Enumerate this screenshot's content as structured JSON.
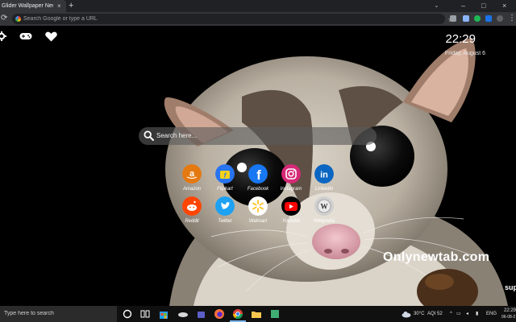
{
  "browser": {
    "tab_title": "Glider Wallpaper New Tab",
    "tab_close": "×",
    "new_tab": "+",
    "tabstrip_chevron": "⌄",
    "window_controls": {
      "minimize": "–",
      "maximize": "□",
      "close": "×"
    },
    "omnibox_placeholder": "Search Google or type a URL"
  },
  "page": {
    "clock_time": "22:29",
    "clock_date": "Friday, August 6",
    "search_placeholder": "Search here...",
    "watermark": "Onlynewtab.com",
    "edge_text": "sup",
    "quick_links": [
      {
        "label": "Amazon",
        "icon": "amazon-icon",
        "color": "#e47911"
      },
      {
        "label": "Flipkart",
        "icon": "flipkart-icon",
        "color": "#2874f0"
      },
      {
        "label": "Facebook",
        "icon": "facebook-icon",
        "color": "#1877f2"
      },
      {
        "label": "Instagram",
        "icon": "instagram-icon",
        "color": "#d62976"
      },
      {
        "label": "Linkedin",
        "icon": "linkedin-icon",
        "color": "#0a66c2"
      },
      {
        "label": "Reddit",
        "icon": "reddit-icon",
        "color": "#ff4500"
      },
      {
        "label": "Twitter",
        "icon": "twitter-icon",
        "color": "#1da1f2"
      },
      {
        "label": "Walmart",
        "icon": "walmart-icon",
        "color": "#0071ce"
      },
      {
        "label": "Youtube",
        "icon": "youtube-icon",
        "color": "#ff0000"
      },
      {
        "label": "Wikipedia",
        "icon": "wikipedia-icon",
        "color": "#cfcfcf"
      }
    ]
  },
  "taskbar": {
    "search_placeholder": "Type here to search",
    "weather": "30°C",
    "aqi": "AQI 52",
    "language": "ENG",
    "time": "22:29",
    "date": "06-08-2"
  }
}
